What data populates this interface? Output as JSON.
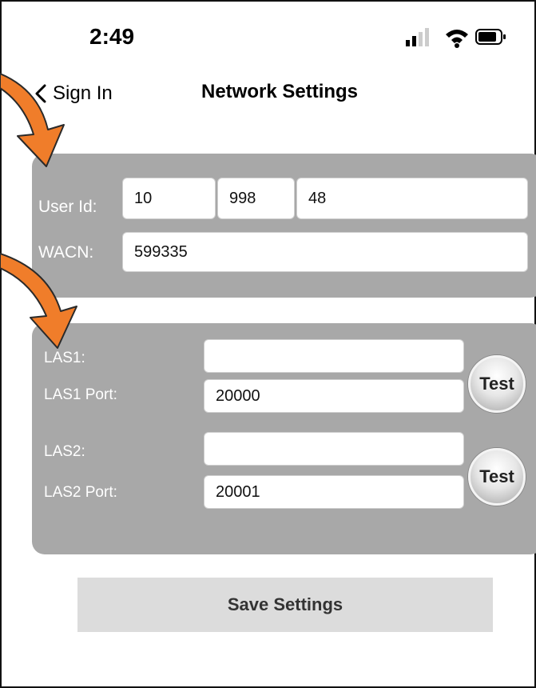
{
  "status_bar": {
    "time": "2:49"
  },
  "nav": {
    "back_label": "Sign In",
    "title": "Network Settings"
  },
  "user_panel": {
    "user_id_label": "User Id:",
    "user_id_parts": [
      "10",
      "998",
      "48"
    ],
    "wacn_label": "WACN:",
    "wacn_value": "599335"
  },
  "las_panel": {
    "las1_label": "LAS1:",
    "las1_value": "",
    "las1_port_label": "LAS1 Port:",
    "las1_port_value": "20000",
    "las2_label": "LAS2:",
    "las2_value": "",
    "las2_port_label": "LAS2 Port:",
    "las2_port_value": "20001",
    "test_label": "Test"
  },
  "save_label": "Save Settings",
  "colors": {
    "panel": "#a8a8a8",
    "arrow": "#f07d2a",
    "save_bg": "#dcdcdc"
  }
}
